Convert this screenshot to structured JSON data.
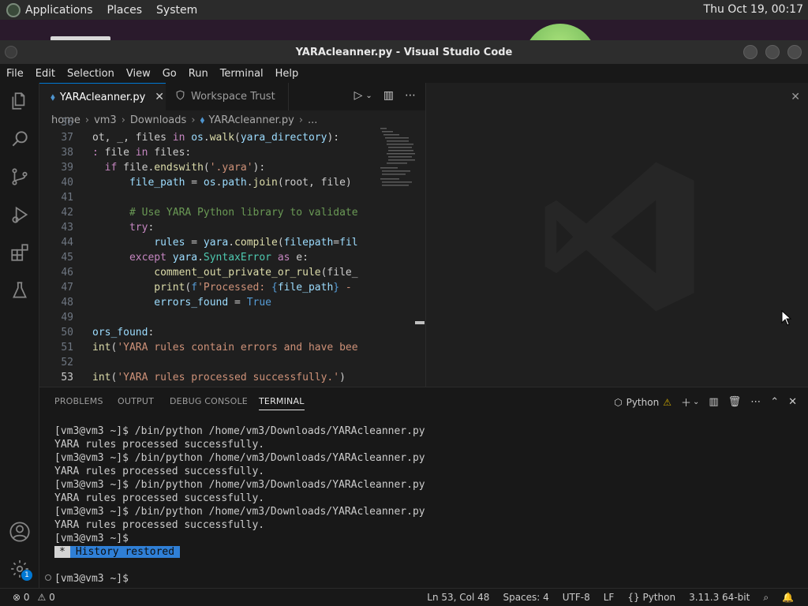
{
  "topbar": {
    "menus": [
      "Applications",
      "Places",
      "System"
    ],
    "clock": "Thu Oct 19, 00:17"
  },
  "window": {
    "title": "YARAcleanner.py - Visual Studio Code"
  },
  "menubar": [
    "File",
    "Edit",
    "Selection",
    "View",
    "Go",
    "Run",
    "Terminal",
    "Help"
  ],
  "tabs": [
    {
      "label": "YARAcleanner.py",
      "active": true
    },
    {
      "label": "Workspace Trust",
      "active": false
    }
  ],
  "breadcrumb": [
    "home",
    "vm3",
    "Downloads",
    "YARAcleanner.py",
    "..."
  ],
  "code": {
    "lines": [
      {
        "num": "36",
        "parts": []
      },
      {
        "num": "37",
        "parts": [
          [
            "",
            "ot, _, files "
          ],
          [
            "kw",
            "in"
          ],
          [
            "",
            " "
          ],
          [
            "var",
            "os"
          ],
          [
            "",
            "."
          ],
          [
            "fn",
            "walk"
          ],
          [
            "",
            "("
          ],
          [
            "var",
            "yara_directory"
          ],
          [
            "",
            "):"
          ]
        ]
      },
      {
        "num": "38",
        "parts": [
          [
            "kw",
            ": "
          ],
          [
            "kw",
            ""
          ],
          [
            "",
            "file "
          ],
          [
            "kw",
            "in"
          ],
          [
            "",
            " files:"
          ]
        ]
      },
      {
        "num": "39",
        "parts": [
          [
            "",
            "  "
          ],
          [
            "kw",
            "if"
          ],
          [
            "",
            " file."
          ],
          [
            "fn",
            "endswith"
          ],
          [
            "",
            "("
          ],
          [
            "str",
            "'.yara'"
          ],
          [
            "",
            "):"
          ]
        ]
      },
      {
        "num": "40",
        "parts": [
          [
            "",
            "      "
          ],
          [
            "var",
            "file_path"
          ],
          [
            "",
            " = "
          ],
          [
            "var",
            "os"
          ],
          [
            "",
            "."
          ],
          [
            "var",
            "path"
          ],
          [
            "",
            "."
          ],
          [
            "fn",
            "join"
          ],
          [
            "",
            "(root, file)"
          ]
        ]
      },
      {
        "num": "41",
        "parts": []
      },
      {
        "num": "42",
        "parts": [
          [
            "",
            "      "
          ],
          [
            "cm",
            "# Use YARA Python library to validate"
          ]
        ]
      },
      {
        "num": "43",
        "parts": [
          [
            "",
            "      "
          ],
          [
            "kw",
            "try"
          ],
          [
            "",
            ":"
          ]
        ]
      },
      {
        "num": "44",
        "parts": [
          [
            "",
            "          "
          ],
          [
            "var",
            "rules"
          ],
          [
            "",
            " = "
          ],
          [
            "var",
            "yara"
          ],
          [
            "",
            "."
          ],
          [
            "fn",
            "compile"
          ],
          [
            "",
            "("
          ],
          [
            "var",
            "filepath"
          ],
          [
            "",
            "="
          ],
          [
            "var",
            "fil"
          ]
        ]
      },
      {
        "num": "45",
        "parts": [
          [
            "",
            "      "
          ],
          [
            "kw",
            "except"
          ],
          [
            "",
            " "
          ],
          [
            "var",
            "yara"
          ],
          [
            "",
            "."
          ],
          [
            "cls",
            "SyntaxError"
          ],
          [
            "",
            " "
          ],
          [
            "kw",
            "as"
          ],
          [
            "",
            " e:"
          ]
        ]
      },
      {
        "num": "46",
        "parts": [
          [
            "",
            "          "
          ],
          [
            "fn",
            "comment_out_private_or_rule"
          ],
          [
            "",
            "(file_"
          ]
        ]
      },
      {
        "num": "47",
        "parts": [
          [
            "",
            "          "
          ],
          [
            "fn",
            "print"
          ],
          [
            "",
            "("
          ],
          [
            "bool",
            "f"
          ],
          [
            "str",
            "'Processed: "
          ],
          [
            "bool",
            "{"
          ],
          [
            "var",
            "file_path"
          ],
          [
            "bool",
            "}"
          ],
          [
            "str",
            " -"
          ]
        ]
      },
      {
        "num": "48",
        "parts": [
          [
            "",
            "          "
          ],
          [
            "var",
            "errors_found"
          ],
          [
            "",
            " = "
          ],
          [
            "bool",
            "True"
          ]
        ]
      },
      {
        "num": "49",
        "parts": []
      },
      {
        "num": "50",
        "parts": [
          [
            "var",
            "ors_found"
          ],
          [
            "",
            ":"
          ]
        ]
      },
      {
        "num": "51",
        "parts": [
          [
            "fn",
            "int"
          ],
          [
            "",
            "("
          ],
          [
            "str",
            "'YARA rules contain errors and have bee"
          ]
        ]
      },
      {
        "num": "52",
        "parts": []
      },
      {
        "num": "53",
        "parts": [
          [
            "fn",
            "int"
          ],
          [
            "",
            "("
          ],
          [
            "str",
            "'YARA rules processed successfully.'"
          ],
          [
            "",
            ")"
          ]
        ],
        "current": true
      }
    ]
  },
  "panel": {
    "tabs": [
      "PROBLEMS",
      "OUTPUT",
      "DEBUG CONSOLE",
      "TERMINAL"
    ],
    "active_tab": "TERMINAL",
    "terminal_label": "Python",
    "terminal_lines": [
      "[vm3@vm3 ~]$ /bin/python /home/vm3/Downloads/YARAcleanner.py",
      "YARA rules processed successfully.",
      "[vm3@vm3 ~]$ /bin/python /home/vm3/Downloads/YARAcleanner.py",
      "YARA rules processed successfully.",
      "[vm3@vm3 ~]$ /bin/python /home/vm3/Downloads/YARAcleanner.py",
      "YARA rules processed successfully.",
      "[vm3@vm3 ~]$ /bin/python /home/vm3/Downloads/YARAcleanner.py",
      "YARA rules processed successfully.",
      "[vm3@vm3 ~]$"
    ],
    "history_star": "*",
    "history_text": "History restored",
    "prompt": "[vm3@vm3 ~]$"
  },
  "statusbar": {
    "errors": "0",
    "warnings": "0",
    "position": "Ln 53, Col 48",
    "spaces": "Spaces: 4",
    "encoding": "UTF-8",
    "eol": "LF",
    "language": "Python",
    "interpreter": "3.11.3 64-bit"
  },
  "manage_badge": "1",
  "colors": {
    "accent": "#0078d4",
    "history_highlight": "#2f7fd6",
    "warning": "#cca700"
  }
}
